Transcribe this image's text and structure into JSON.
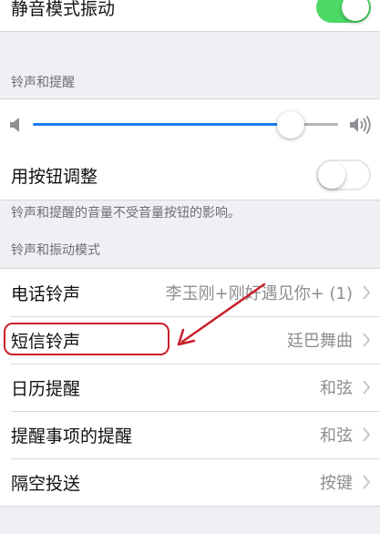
{
  "top_partial": {
    "label": "静音模式振动",
    "toggle_on": true
  },
  "ringer_section": {
    "header": "铃声和提醒",
    "volume_level": 0.88,
    "change_with_buttons": {
      "label": "用按钮调整",
      "toggle_on": false
    },
    "footer": "铃声和提醒的音量不受音量按钮的影响。"
  },
  "patterns_section": {
    "header": "铃声和振动模式",
    "items": [
      {
        "label": "电话铃声",
        "value": "李玉刚+刚好遇见你+ (1)"
      },
      {
        "label": "短信铃声",
        "value": "廷巴舞曲"
      },
      {
        "label": "日历提醒",
        "value": "和弦"
      },
      {
        "label": "提醒事项的提醒",
        "value": "和弦"
      },
      {
        "label": "隔空投送",
        "value": "按键"
      }
    ]
  },
  "colors": {
    "accent": "#1a7cf5",
    "toggle_on": "#4cd964",
    "annotation": "#c8202a"
  },
  "icons": {
    "volume_low": "speaker-low-icon",
    "volume_high": "speaker-high-icon",
    "chevron": "chevron-right-icon"
  }
}
